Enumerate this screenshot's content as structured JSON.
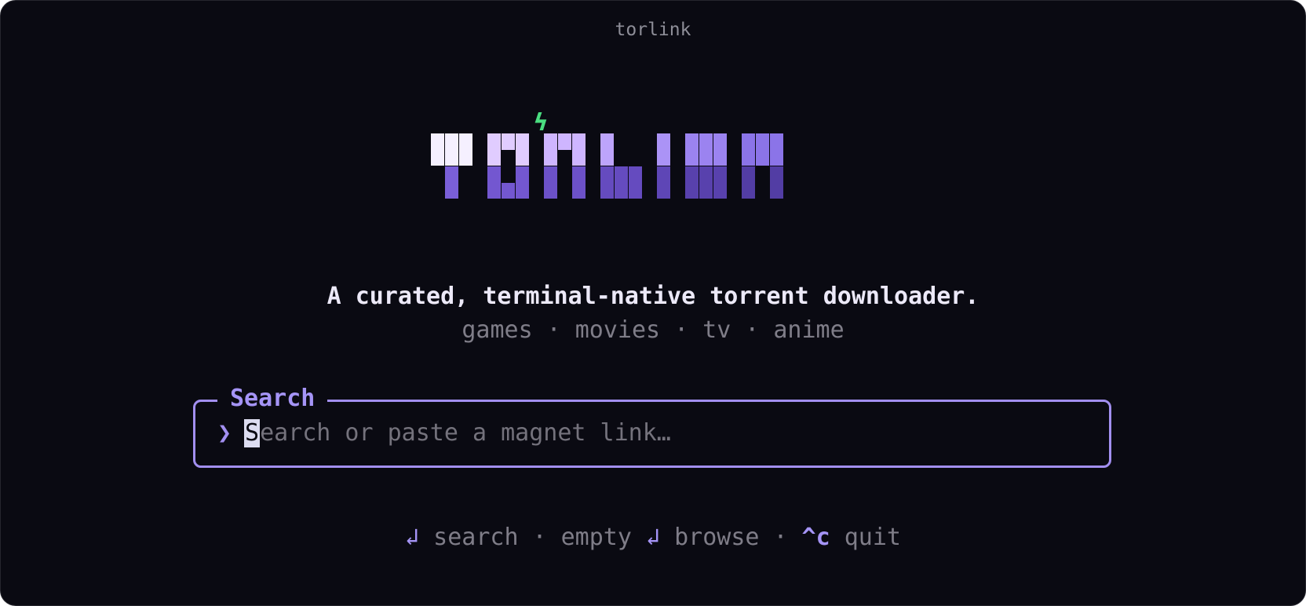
{
  "window": {
    "title": "torlink"
  },
  "logo": {
    "text": "TORLINK",
    "bolt_glyph": "ϟ",
    "bolt_color": "#4ade80",
    "top_colors": [
      "#f5f0ff",
      "#e0ccff",
      "#ceb5ff",
      "#bda4fb",
      "#ab93f6",
      "#9b83f0",
      "#8b74e8"
    ],
    "bottom_colors": [
      "#7a5fd8",
      "#7357d0",
      "#6c51c8",
      "#654bbf",
      "#5e46b6",
      "#5841ad",
      "#523da4"
    ]
  },
  "tagline": "A curated, terminal-native torrent downloader.",
  "categories": [
    "games",
    "movies",
    "tv",
    "anime"
  ],
  "category_separator": "·",
  "search": {
    "title": "Search",
    "prompt_glyph": "❯",
    "cursor_char": "S",
    "placeholder_rest": "earch or paste a magnet link…",
    "accent_color": "#a28ff0"
  },
  "hints": [
    {
      "key": "↲",
      "label": "search"
    },
    {
      "prefix": "empty",
      "key": "↲",
      "label": "browse"
    },
    {
      "key": "^c",
      "label": "quit"
    }
  ],
  "hint_separator": "·"
}
